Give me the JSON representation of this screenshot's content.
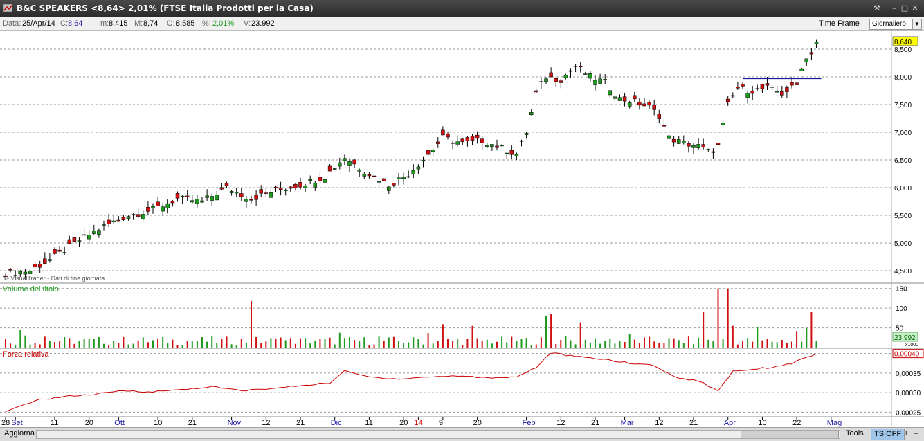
{
  "window": {
    "title": "B&C SPEAKERS <8,64> 2,01%  (FTSE Italia Prodotti per la Casa)",
    "buttons": {
      "tool": "⚒",
      "minimize": "–",
      "maximize": "□",
      "close": "✕"
    }
  },
  "info": {
    "data_label": "Data:",
    "data_value": "25/Apr/14",
    "c_label": "C:",
    "c_value": "8,64",
    "m_label": "m:",
    "m_value": "8,415",
    "M_label": "M:",
    "M_value": "8,74",
    "o_label": "O:",
    "o_value": "8,585",
    "pct_label": "%:",
    "pct_value": "2,01%",
    "v_label": "V:",
    "v_value": "23.992",
    "time_frame_label": "Time Frame",
    "time_frame_value": "Giornaliero"
  },
  "colors": {
    "up": "#1f9a1f",
    "down": "#d01010",
    "rs_line": "#cc0000",
    "hline": "#1a1aa0",
    "price_label_bg": "#ffff00",
    "vol_label_bg": "#c8f0c8"
  },
  "chart_data": [
    {
      "type": "candlestick",
      "watermark": "© VisualTrader - Dati di fine giornata",
      "ylim": [
        4.3,
        8.8
      ],
      "yticks": [
        "8,500",
        "8,000",
        "7,500",
        "7,000",
        "6,500",
        "6,000",
        "5,500",
        "5,000",
        "4,500"
      ],
      "last_price_label": "8,640",
      "resistance_level": 7.97,
      "xlabels": [
        {
          "text": "28",
          "i": 0,
          "color": "#000"
        },
        {
          "text": "Set",
          "i": 2,
          "color": "#1a1aa0"
        },
        {
          "text": "11",
          "i": 10,
          "color": "#000"
        },
        {
          "text": "20",
          "i": 17,
          "color": "#000"
        },
        {
          "text": "Ott",
          "i": 23,
          "color": "#1a1aa0"
        },
        {
          "text": "10",
          "i": 31,
          "color": "#000"
        },
        {
          "text": "21",
          "i": 38,
          "color": "#000"
        },
        {
          "text": "Nov",
          "i": 46,
          "color": "#1a1aa0"
        },
        {
          "text": "12",
          "i": 53,
          "color": "#000"
        },
        {
          "text": "21",
          "i": 60,
          "color": "#000"
        },
        {
          "text": "Dic",
          "i": 67,
          "color": "#1a1aa0"
        },
        {
          "text": "11",
          "i": 74,
          "color": "#000"
        },
        {
          "text": "20",
          "i": 81,
          "color": "#000"
        },
        {
          "text": "14",
          "i": 84,
          "color": "#cc0000"
        },
        {
          "text": "9",
          "i": 89,
          "color": "#000"
        },
        {
          "text": "20",
          "i": 96,
          "color": "#000"
        },
        {
          "text": "Feb",
          "i": 106,
          "color": "#1a1aa0"
        },
        {
          "text": "12",
          "i": 113,
          "color": "#000"
        },
        {
          "text": "21",
          "i": 120,
          "color": "#000"
        },
        {
          "text": "Mar",
          "i": 126,
          "color": "#1a1aa0"
        },
        {
          "text": "12",
          "i": 133,
          "color": "#000"
        },
        {
          "text": "21",
          "i": 140,
          "color": "#000"
        },
        {
          "text": "Apr",
          "i": 147,
          "color": "#1a1aa0"
        },
        {
          "text": "10",
          "i": 154,
          "color": "#000"
        },
        {
          "text": "22",
          "i": 161,
          "color": "#000"
        },
        {
          "text": "Mag",
          "i": 168,
          "color": "#1a1aa0"
        }
      ],
      "anchors": [
        [
          0,
          4.45
        ],
        [
          5,
          4.5
        ],
        [
          10,
          4.75
        ],
        [
          15,
          5.05
        ],
        [
          20,
          5.3
        ],
        [
          25,
          5.5
        ],
        [
          30,
          5.6
        ],
        [
          35,
          5.8
        ],
        [
          40,
          5.75
        ],
        [
          45,
          6.0
        ],
        [
          50,
          5.8
        ],
        [
          55,
          5.95
        ],
        [
          60,
          6.05
        ],
        [
          65,
          6.2
        ],
        [
          69,
          6.55
        ],
        [
          73,
          6.3
        ],
        [
          78,
          6.05
        ],
        [
          82,
          6.25
        ],
        [
          86,
          6.6
        ],
        [
          89,
          6.9
        ],
        [
          93,
          6.8
        ],
        [
          97,
          6.85
        ],
        [
          100,
          6.75
        ],
        [
          104,
          6.6
        ],
        [
          106,
          7.0
        ],
        [
          108,
          7.7
        ],
        [
          110,
          8.0
        ],
        [
          113,
          7.95
        ],
        [
          116,
          8.2
        ],
        [
          119,
          8.0
        ],
        [
          122,
          7.9
        ],
        [
          125,
          7.6
        ],
        [
          128,
          7.55
        ],
        [
          131,
          7.45
        ],
        [
          133,
          7.3
        ],
        [
          135,
          6.9
        ],
        [
          138,
          6.8
        ],
        [
          141,
          6.75
        ],
        [
          143,
          6.65
        ],
        [
          145,
          6.75
        ],
        [
          147,
          7.5
        ],
        [
          149,
          7.8
        ],
        [
          152,
          7.75
        ],
        [
          155,
          7.8
        ],
        [
          158,
          7.7
        ],
        [
          161,
          7.85
        ],
        [
          162,
          8.2
        ],
        [
          164,
          8.45
        ],
        [
          165,
          8.64
        ]
      ],
      "note": "candle OHLC series derived from the anchor closes"
    },
    {
      "type": "bar",
      "series_name": "Volume del titolo",
      "yticks": [
        "150",
        "100",
        "50"
      ],
      "ylim": [
        0,
        160
      ],
      "last_label": "23.992",
      "scale_label": "x1000",
      "spikes": [
        [
          50,
          118
        ],
        [
          110,
          80
        ],
        [
          111,
          85
        ],
        [
          142,
          90
        ],
        [
          145,
          150
        ],
        [
          147,
          148
        ],
        [
          148,
          55
        ],
        [
          163,
          50
        ],
        [
          164,
          90
        ]
      ]
    },
    {
      "type": "line",
      "series_name": "Forza relativa",
      "yticks": [
        "0,00040",
        "0,00035",
        "0,00030",
        "0,00025"
      ],
      "ylim": [
        0.00024,
        0.00041
      ],
      "last_label": "0,00040",
      "anchors": [
        [
          0,
          0.00025
        ],
        [
          6,
          0.00028
        ],
        [
          12,
          0.00029
        ],
        [
          18,
          0.000295
        ],
        [
          24,
          0.000305
        ],
        [
          30,
          0.000302
        ],
        [
          36,
          0.000308
        ],
        [
          42,
          0.000315
        ],
        [
          48,
          0.000305
        ],
        [
          54,
          0.00031
        ],
        [
          60,
          0.000318
        ],
        [
          66,
          0.000325
        ],
        [
          69,
          0.000355
        ],
        [
          74,
          0.00034
        ],
        [
          80,
          0.000335
        ],
        [
          86,
          0.00034
        ],
        [
          92,
          0.000343
        ],
        [
          98,
          0.000338
        ],
        [
          104,
          0.00034
        ],
        [
          108,
          0.000365
        ],
        [
          111,
          0.000402
        ],
        [
          116,
          0.000392
        ],
        [
          122,
          0.000385
        ],
        [
          127,
          0.000375
        ],
        [
          132,
          0.00037
        ],
        [
          136,
          0.00034
        ],
        [
          141,
          0.00033
        ],
        [
          145,
          0.000305
        ],
        [
          148,
          0.000355
        ],
        [
          152,
          0.00036
        ],
        [
          156,
          0.000365
        ],
        [
          160,
          0.000375
        ],
        [
          163,
          0.00039
        ],
        [
          165,
          0.0004
        ]
      ]
    }
  ],
  "bottom": {
    "refresh": "Aggiorna",
    "tools": "Tools",
    "ts_off": "TS OFF",
    "plus": "+",
    "minus": "–"
  }
}
